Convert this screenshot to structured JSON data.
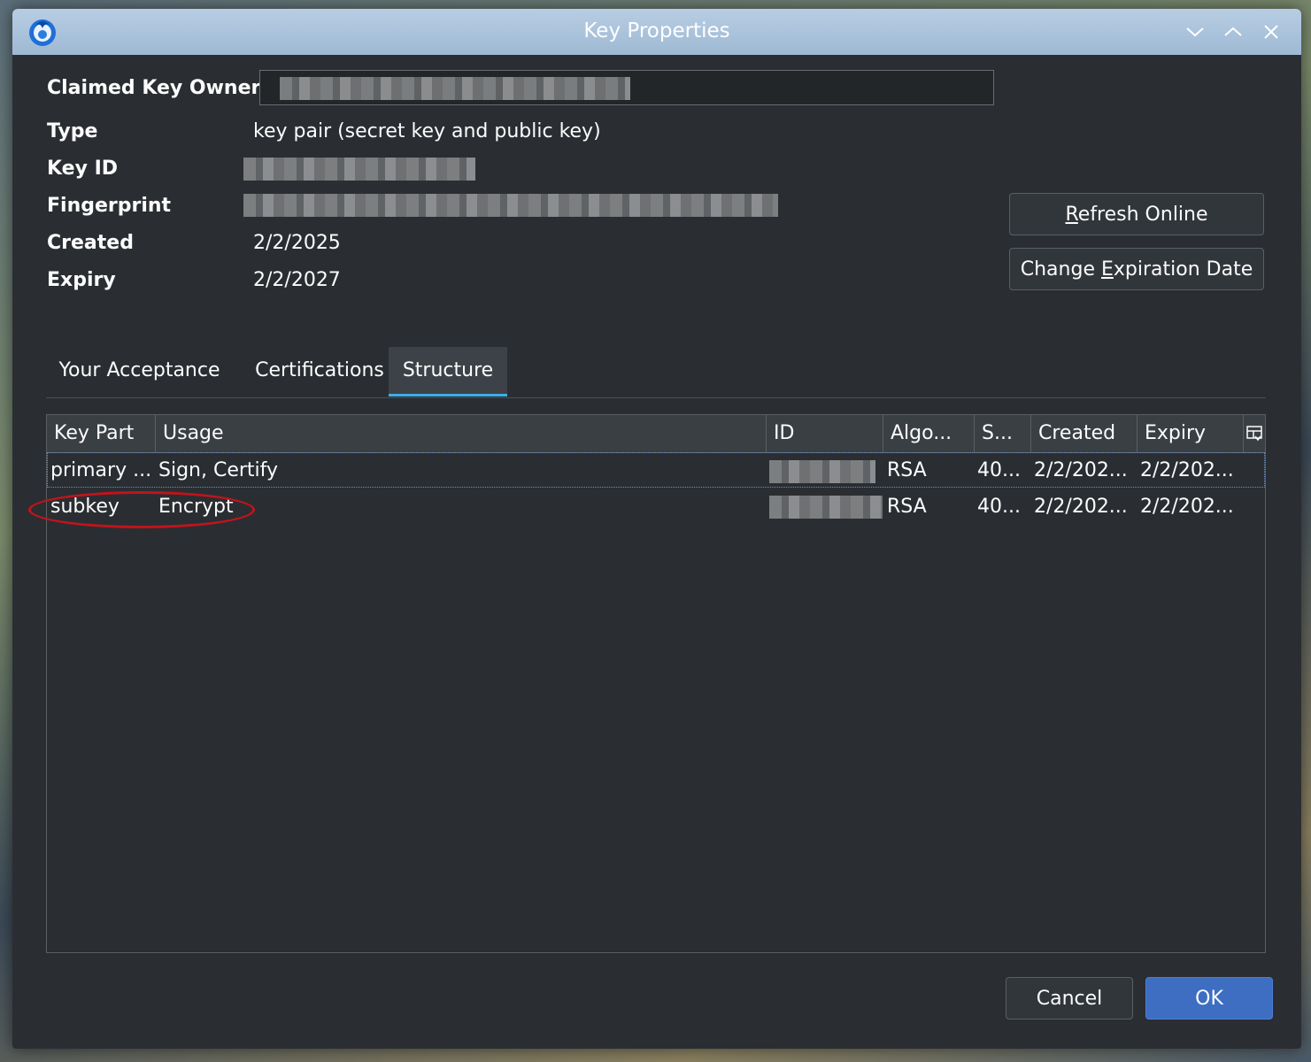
{
  "window": {
    "title": "Key Properties"
  },
  "fields": {
    "owner_label": "Claimed Key Owner",
    "type_label": "Type",
    "type_value": "key pair (secret key and public key)",
    "keyid_label": "Key ID",
    "fingerprint_label": "Fingerprint",
    "created_label": "Created",
    "created_value": "2/2/2025",
    "expiry_label": "Expiry",
    "expiry_value": "2/2/2027"
  },
  "actions": {
    "refresh_prefix": "",
    "refresh_mnemonic": "R",
    "refresh_rest": "efresh Online",
    "change_prefix": "Change ",
    "change_mnemonic": "E",
    "change_rest": "xpiration Date",
    "cancel": "Cancel",
    "ok": "OK"
  },
  "tabs": [
    {
      "label": "Your Acceptance",
      "active": false
    },
    {
      "label": "Certifications",
      "active": false
    },
    {
      "label": "Structure",
      "active": true
    }
  ],
  "table": {
    "columns": [
      "Key Part",
      "Usage",
      "ID",
      "Algo...",
      "S...",
      "Created",
      "Expiry"
    ],
    "rows": [
      {
        "key_part": "primary ...",
        "usage": "Sign, Certify",
        "algo": "RSA",
        "size": "40...",
        "created": "2/2/202...",
        "expiry": "2/2/202..."
      },
      {
        "key_part": "subkey",
        "usage": "Encrypt",
        "algo": "RSA",
        "size": "40...",
        "created": "2/2/202...",
        "expiry": "2/2/202..."
      }
    ]
  },
  "icons": {
    "app": "thunderbird-icon",
    "minimize": "chevron-down-icon",
    "maximize": "chevron-up-icon",
    "close": "close-icon",
    "column_menu": "column-picker-icon"
  },
  "colors": {
    "accent": "#3daee9",
    "ok_button": "#3d6ec2",
    "annotation": "#c0141c"
  }
}
